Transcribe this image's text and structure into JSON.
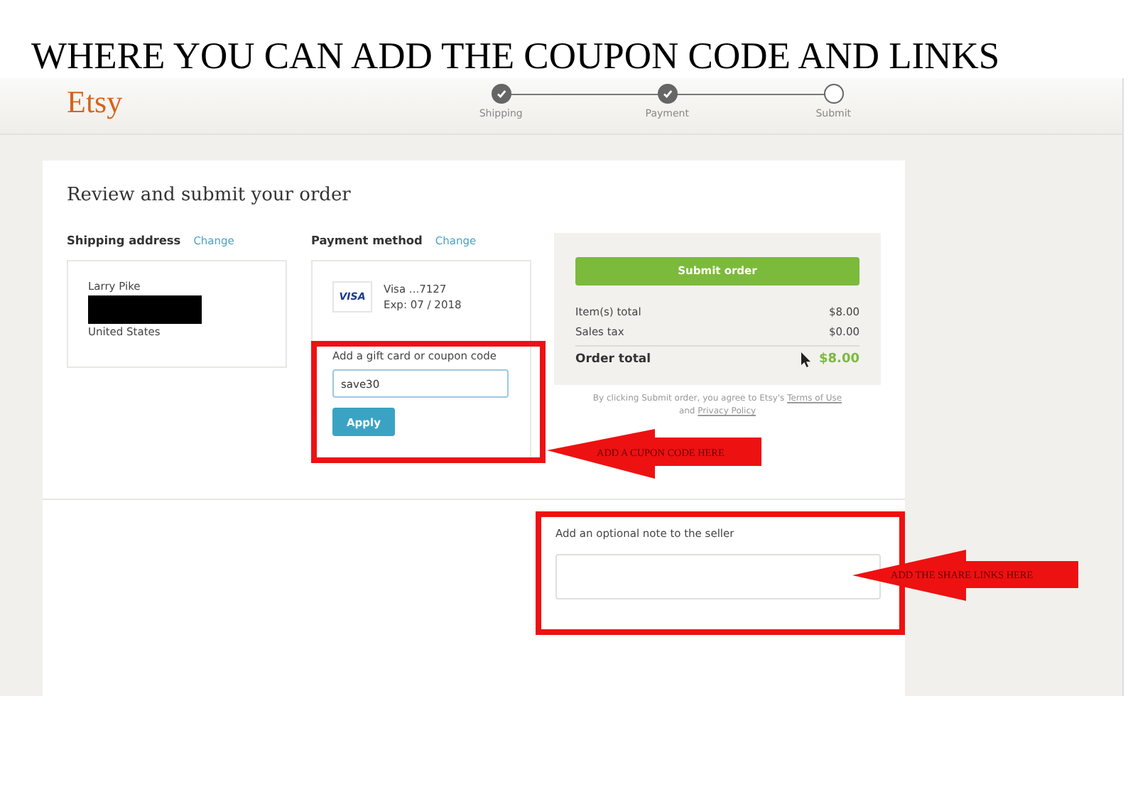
{
  "caption": "WHERE YOU CAN ADD THE COUPON CODE AND LINKS",
  "header": {
    "logo": "Etsy",
    "steps": [
      {
        "label": "Shipping",
        "completed": true
      },
      {
        "label": "Payment",
        "completed": true
      },
      {
        "label": "Submit",
        "completed": false
      }
    ]
  },
  "order": {
    "title": "Review and submit your order",
    "shipping": {
      "heading": "Shipping address",
      "change": "Change",
      "name": "Larry Pike",
      "country": "United States"
    },
    "payment": {
      "heading": "Payment method",
      "change": "Change",
      "card_brand": "VISA",
      "card_number": "Visa ...7127",
      "expiry": "Exp: 07 / 2018"
    },
    "coupon": {
      "label": "Add a gift card or coupon code",
      "value": "save30",
      "button": "Apply"
    },
    "summary": {
      "button": "Submit order",
      "lines": [
        {
          "label": "Item(s) total",
          "amount": "$8.00"
        },
        {
          "label": "Sales tax",
          "amount": "$0.00"
        }
      ],
      "total_label": "Order total",
      "total_amount": "$8.00",
      "legal": "By clicking Submit order, you agree to Etsy's",
      "terms": "Terms of Use",
      "and": "and",
      "privacy": "Privacy Policy"
    },
    "note": {
      "label": "Add an optional note to the seller"
    }
  },
  "annotations": [
    {
      "text": "ADD A CUPON CODE HERE"
    },
    {
      "text": "ADD THE SHARE LINKS HERE"
    }
  ]
}
